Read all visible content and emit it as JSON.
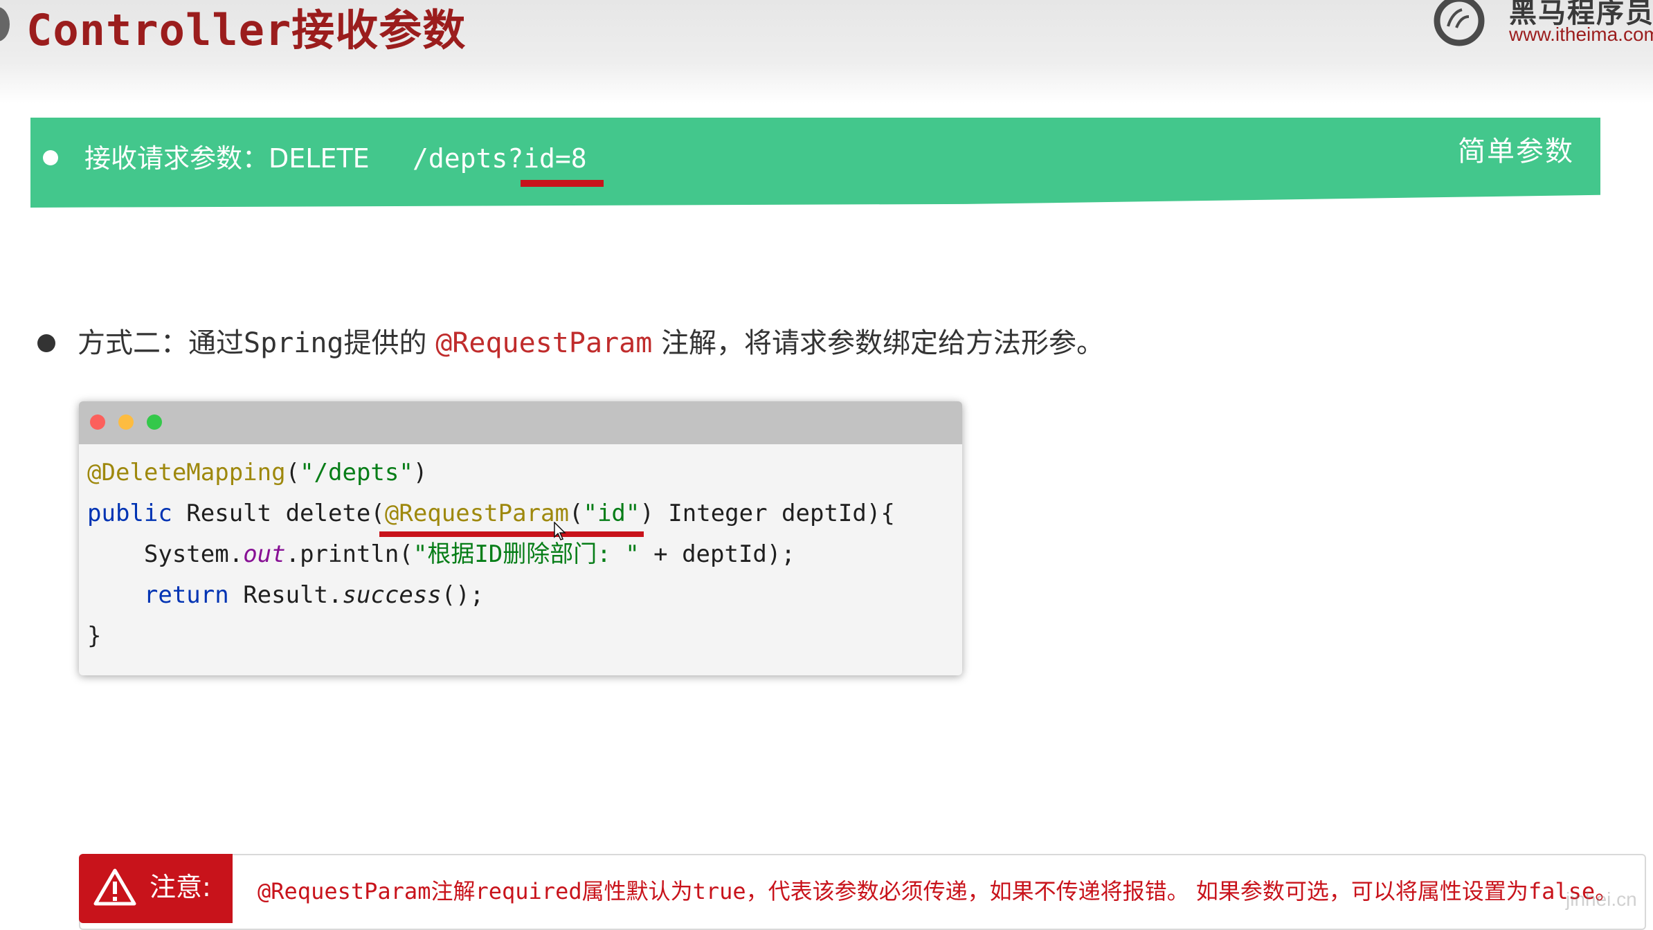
{
  "header": {
    "title": "Controller接收参数",
    "logo_name": "黑马程序员",
    "logo_url": "www.itheima.com"
  },
  "banner": {
    "label": "接收请求参数：DELETE",
    "url": "/depts?id=8",
    "tag": "简单参数"
  },
  "bullet": {
    "prefix": "方式二：通过",
    "spring": "Spring",
    "mid": "提供的 ",
    "annotation": "@RequestParam",
    "suffix": " 注解，将请求参数绑定给方法形参。"
  },
  "code": {
    "line1_anno": "@DeleteMapping",
    "line1_open": "(",
    "line1_str": "\"/depts\"",
    "line1_close": ")",
    "line2_kw": "public",
    "line2_a": " Result delete(",
    "line2_anno": "@RequestParam",
    "line2_open": "(",
    "line2_str": "\"id\"",
    "line2_b": ") Integer deptId){",
    "line3_indent": "    ",
    "line3_a": "System.",
    "line3_field": "out",
    "line3_b": ".println(",
    "line3_str": "\"根据ID删除部门: \"",
    "line3_c": " + deptId);",
    "line4_indent": "    ",
    "line4_kw": "return",
    "line4_a": " Result.",
    "line4_method": "success",
    "line4_b": "();",
    "line5": "}"
  },
  "note": {
    "label": "注意:",
    "anno": "@RequestParam",
    "t1": "注解",
    "required": "required",
    "t2": "属性默认为",
    "true_val": "true",
    "t3": "，代表该参数必须传递，如果不传递将报错。 如果参数可选，可以将属性设置为",
    "false_val": "false",
    "t4": "。"
  },
  "watermark": "jinhei.cn",
  "colors": {
    "title_red": "#9b1d1d",
    "banner_green": "#43c78c",
    "accent_red": "#c8131b",
    "annotation_yellow": "#9e880d",
    "string_green": "#067d17",
    "keyword_blue": "#0033b3"
  }
}
